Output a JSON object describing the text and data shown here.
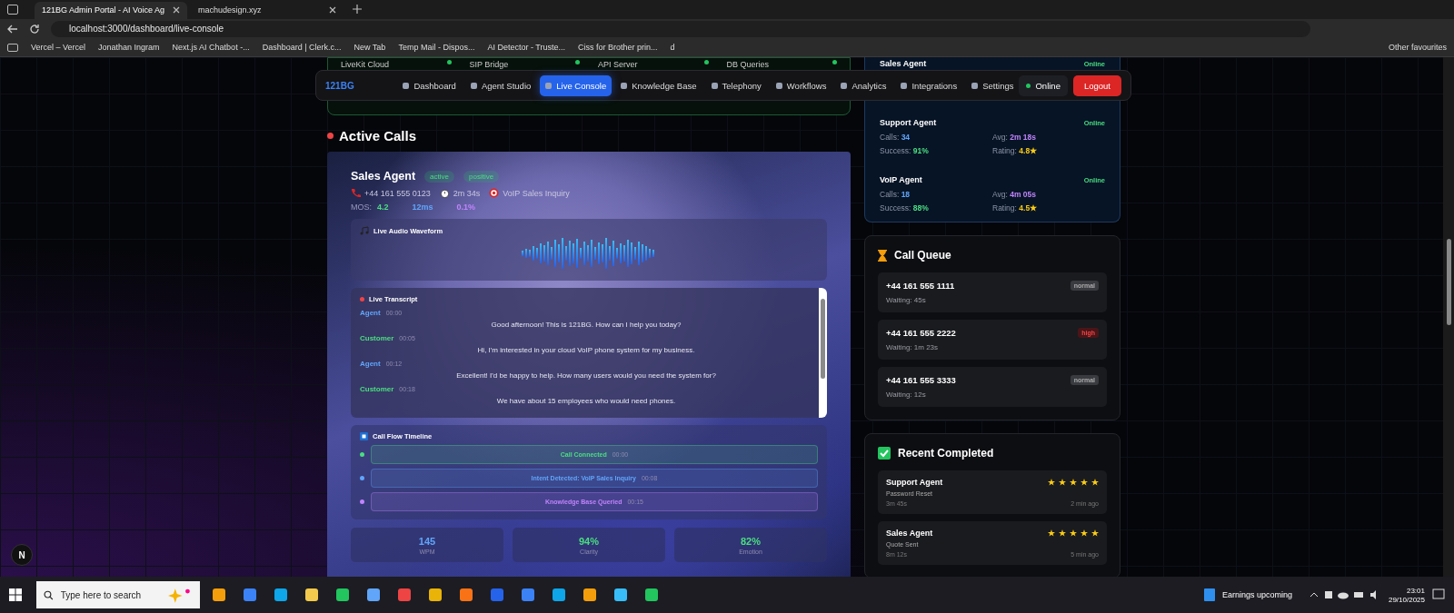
{
  "browser": {
    "tabs": [
      {
        "title": "121BG Admin Portal - AI Voice Ag",
        "selected": true
      },
      {
        "title": "machudesign.xyz",
        "selected": false
      }
    ],
    "url": "localhost:3000/dashboard/live-console",
    "bookmarks": [
      "Vercel – Vercel",
      "Jonathan Ingram",
      "Next.js AI Chatbot -...",
      "Dashboard | Clerk.c...",
      "New Tab",
      "Temp Mail - Dispos...",
      "AI Detector - Truste...",
      "Ciss for Brother prin...",
      "d"
    ],
    "other_favourites": "Other favourites"
  },
  "nav": {
    "logo": "121BG",
    "items": [
      {
        "label": "Dashboard",
        "selected": false
      },
      {
        "label": "Agent Studio",
        "selected": false
      },
      {
        "label": "Live Console",
        "selected": true
      },
      {
        "label": "Knowledge Base",
        "selected": false
      },
      {
        "label": "Telephony",
        "selected": false
      },
      {
        "label": "Workflows",
        "selected": false
      },
      {
        "label": "Analytics",
        "selected": false
      },
      {
        "label": "Integrations",
        "selected": false
      },
      {
        "label": "Settings",
        "selected": false
      }
    ],
    "status": "Online",
    "logout": "Logout"
  },
  "services": [
    "LiveKit Cloud",
    "SIP Bridge",
    "API Server",
    "DB Queries"
  ],
  "active_calls": {
    "title": "Active Calls",
    "call": {
      "agent": "Sales Agent",
      "badges": [
        "active",
        "positive"
      ],
      "phone": "+44 161 555 0123",
      "duration": "2m 34s",
      "intent": "VoIP Sales Inquiry",
      "metrics": [
        {
          "label": "MOS:",
          "value": "4.2",
          "color": "#4ade80"
        },
        {
          "value": "12ms",
          "color": "#60a5fa"
        },
        {
          "value": "0.1%",
          "color": "#c084fc"
        }
      ],
      "waveform": {
        "title": "Live Audio Waveform"
      },
      "transcript": {
        "title": "Live Transcript",
        "entries": [
          {
            "speaker": "Agent",
            "kind": "agent",
            "time": "00:00",
            "text": "Good afternoon! This is 121BG. How can I help you today?"
          },
          {
            "speaker": "Customer",
            "kind": "customer",
            "time": "00:05",
            "text": "Hi, I'm interested in your cloud VoIP phone system for my business."
          },
          {
            "speaker": "Agent",
            "kind": "agent",
            "time": "00:12",
            "text": "Excellent! I'd be happy to help. How many users would you need the system for?"
          },
          {
            "speaker": "Customer",
            "kind": "customer",
            "time": "00:18",
            "text": "We have about 15 employees who would need phones."
          }
        ]
      },
      "timeline": {
        "title": "Call Flow Timeline",
        "events": [
          {
            "label": "Call Connected",
            "time": "00:00",
            "color": "#4ade80"
          },
          {
            "label": "Intent Detected: VoIP Sales Inquiry",
            "time": "00:08",
            "color": "#60a5fa"
          },
          {
            "label": "Knowledge Base Queried",
            "time": "00:15",
            "color": "#c084fc"
          }
        ]
      },
      "stats": [
        {
          "value": "145",
          "label": "WPM",
          "color": "#60a5fa"
        },
        {
          "value": "94%",
          "label": "Clarity",
          "color": "#4ade80"
        },
        {
          "value": "82%",
          "label": "Emotion",
          "color": "#4ade80"
        }
      ]
    }
  },
  "agents": [
    {
      "name": "Sales Agent",
      "status": "Online"
    },
    {
      "name": "Support Agent",
      "status": "Online",
      "stats": [
        {
          "label": "Calls:",
          "value": "34",
          "color": "#60a5fa"
        },
        {
          "label": "Avg:",
          "value": "2m 18s",
          "color": "#c084fc"
        },
        {
          "label": "Success:",
          "value": "91%",
          "color": "#4ade80"
        },
        {
          "label": "Rating:",
          "value": "4.8★",
          "color": "#facc15"
        }
      ]
    },
    {
      "name": "VoIP Agent",
      "status": "Online",
      "stats": [
        {
          "label": "Calls:",
          "value": "18",
          "color": "#60a5fa"
        },
        {
          "label": "Avg:",
          "value": "4m 05s",
          "color": "#c084fc"
        },
        {
          "label": "Success:",
          "value": "88%",
          "color": "#4ade80"
        },
        {
          "label": "Rating:",
          "value": "4.5★",
          "color": "#facc15"
        }
      ]
    }
  ],
  "call_queue": {
    "title": "Call Queue",
    "items": [
      {
        "phone": "+44 161 555 1111",
        "wait": "Waiting: 45s",
        "priority": "normal"
      },
      {
        "phone": "+44 161 555 2222",
        "wait": "Waiting: 1m 23s",
        "priority": "high"
      },
      {
        "phone": "+44 161 555 3333",
        "wait": "Waiting: 12s",
        "priority": "normal"
      }
    ]
  },
  "recent_completed": {
    "title": "Recent Completed",
    "items": [
      {
        "agent": "Support Agent",
        "stars": 5,
        "topic": "Password Reset",
        "duration": "3m 45s",
        "ago": "2 min ago"
      },
      {
        "agent": "Sales Agent",
        "stars": 5,
        "topic": "Quote Sent",
        "duration": "8m 12s",
        "ago": "5 min ago"
      }
    ]
  },
  "dev_indicator": "N",
  "taskbar": {
    "search_placeholder": "Type here to search",
    "news": "Earnings upcoming",
    "time": "23:01",
    "date": "29/10/2025"
  }
}
